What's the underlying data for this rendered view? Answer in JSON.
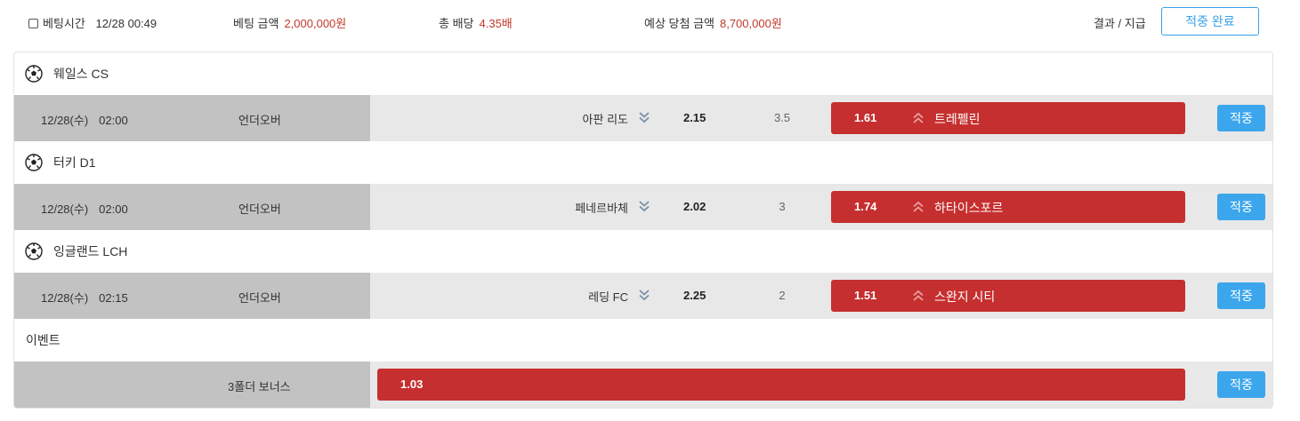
{
  "summary": {
    "bet_time_label": "베팅시간",
    "bet_time": "12/28 00:49",
    "bet_amount_label": "베팅 금액",
    "bet_amount": "2,000,000원",
    "total_odds_label": "총 배당",
    "total_odds": "4.35배",
    "expected_label": "예상 당첨 금액",
    "expected_amount": "8,700,000원",
    "result_label": "결과 / 지급",
    "status_button": "적중 완료"
  },
  "colors": {
    "accent_red": "#c62f2f",
    "hit_blue": "#3ba6ec",
    "amount_red": "#c0392b"
  },
  "bets": [
    {
      "league": "웨일스 CS",
      "icon": "soccer-ball-icon",
      "date": "12/28(수)",
      "time": "02:00",
      "market": "언더오버",
      "home": "아판 리도",
      "home_odds": "2.15",
      "base": "3.5",
      "selected_odds": "1.61",
      "away": "트레펠린",
      "result": "적중"
    },
    {
      "league": "터키 D1",
      "icon": "soccer-ball-icon",
      "date": "12/28(수)",
      "time": "02:00",
      "market": "언더오버",
      "home": "페네르바체",
      "home_odds": "2.02",
      "base": "3",
      "selected_odds": "1.74",
      "away": "하타이스포르",
      "result": "적중"
    },
    {
      "league": "잉글랜드 LCH",
      "icon": "soccer-ball-icon",
      "date": "12/28(수)",
      "time": "02:15",
      "market": "언더오버",
      "home": "레딩 FC",
      "home_odds": "2.25",
      "base": "2",
      "selected_odds": "1.51",
      "away": "스완지 시티",
      "result": "적중"
    }
  ],
  "event": {
    "label": "이벤트",
    "bonus_name": "3폴더 보너스",
    "bonus_odds": "1.03",
    "result": "적중"
  }
}
